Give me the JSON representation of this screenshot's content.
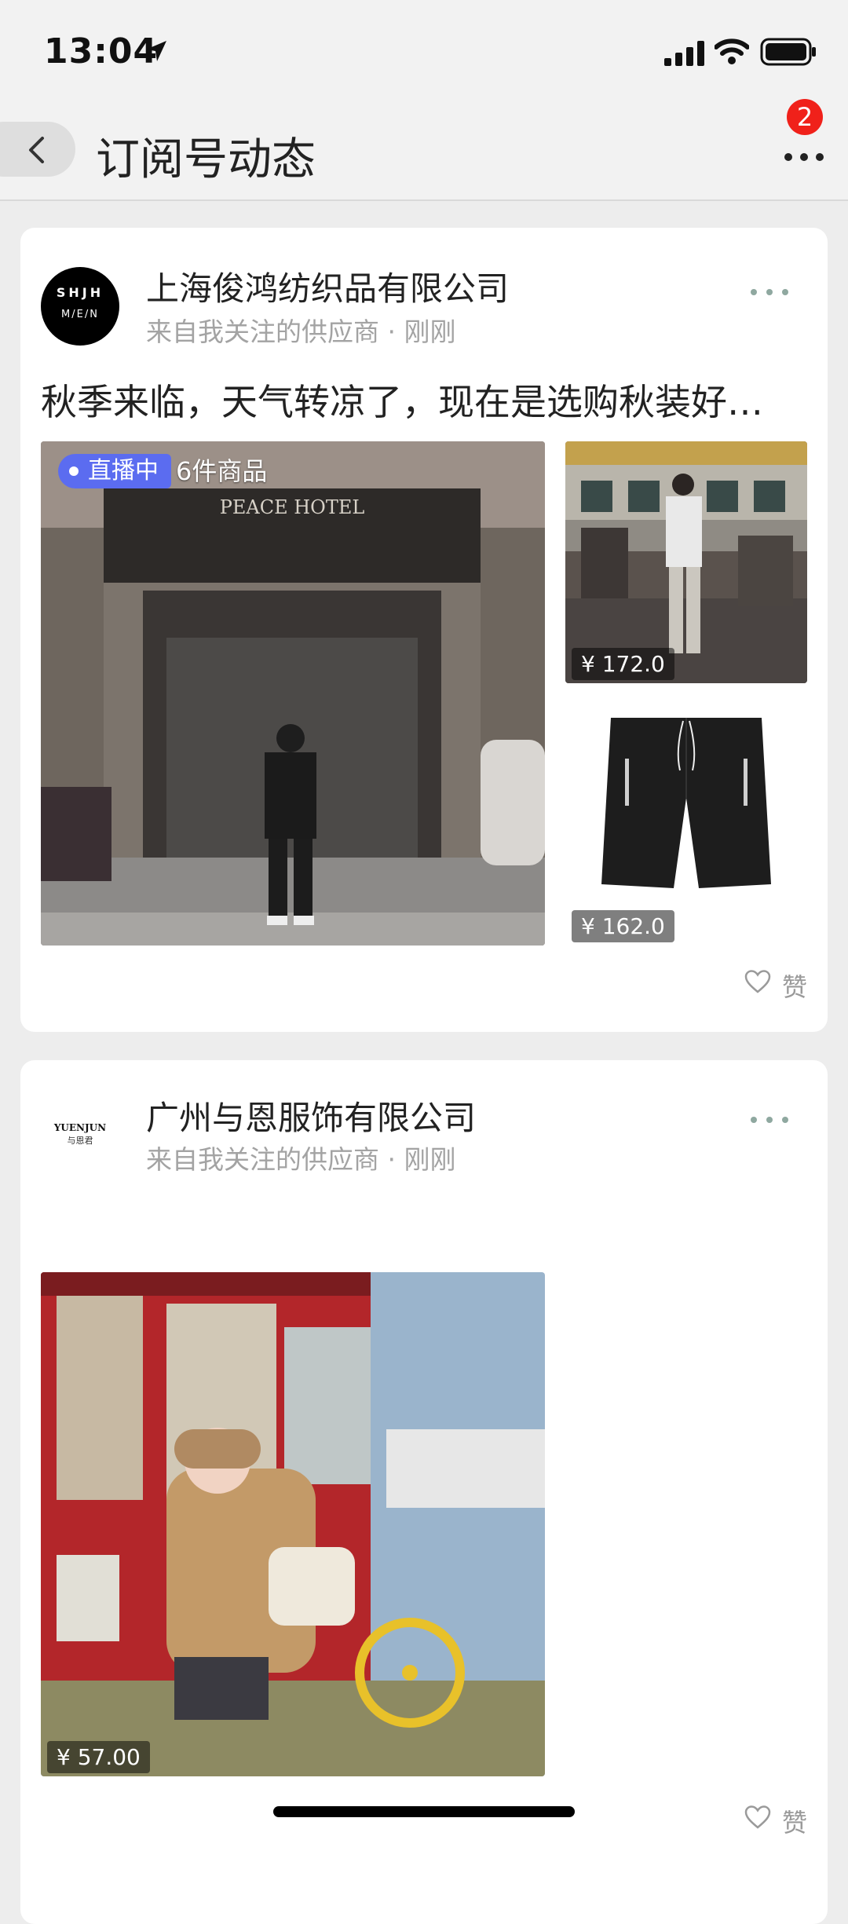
{
  "status": {
    "time": "13:04"
  },
  "nav": {
    "title": "订阅号动态",
    "badge_count": "2"
  },
  "posts": [
    {
      "company": "上海俊鸿纺织品有限公司",
      "source": "来自我关注的供应商 · 刚刚",
      "avatar_text": "SHJH",
      "text": "秋季来临，天气转凉了，现在是选购秋装好时机",
      "live_label": "直播中",
      "item_count": "6件商品",
      "products": [
        {
          "price": "¥ 172.0"
        },
        {
          "price": "¥ 162.0"
        }
      ],
      "like_label": "赞"
    },
    {
      "company": "广州与恩服饰有限公司",
      "source": "来自我关注的供应商 · 刚刚",
      "avatar_text": "YUENJUN",
      "avatar_sub": "与恩君",
      "products": [
        {
          "price": "¥ 57.00"
        }
      ],
      "like_label": "赞"
    }
  ]
}
